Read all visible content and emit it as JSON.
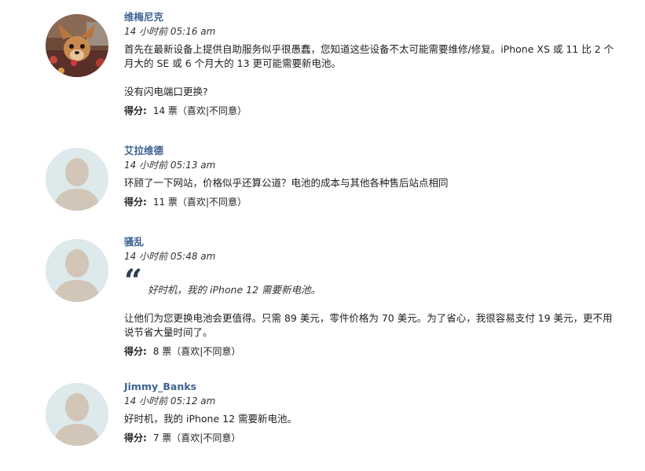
{
  "comments": [
    {
      "author": "维梅尼克",
      "time": "14 小时前 05:16 am",
      "paragraphs": [
        "首先在最新设备上提供自助服务似乎很愚蠢，您知道这些设备不太可能需要维修/修复。iPhone XS 或 11 比 2 个月大的 SE 或 6 个月大的 13 更可能需要新电池。",
        "没有闪电端口更换?"
      ],
      "score_label": "得分:",
      "votes": "14 票",
      "open_paren": "（",
      "like": "喜欢",
      "separator": "|",
      "dislike": "不同意",
      "close_paren": "）"
    },
    {
      "author": "艾拉维德",
      "time": "14 小时前 05:13 am",
      "paragraphs": [
        "环顾了一下网站，价格似乎还算公道？电池的成本与其他各种售后站点相同"
      ],
      "score_label": "得分:",
      "votes": "11 票",
      "open_paren": "（",
      "like": "喜欢",
      "separator": "|",
      "dislike": "不同意",
      "close_paren": "）"
    },
    {
      "author": "骚乱",
      "time": "14 小时前 05:48 am",
      "quote_mark": "“",
      "quote": "好时机，我的 iPhone 12 需要新电池。",
      "paragraphs": [
        "让他们为您更换电池会更值得。只需 89 美元，零件价格为 70 美元。为了省心，我很容易支付 19 美元，更不用说节省大量时间了。"
      ],
      "score_label": "得分:",
      "votes": "8 票",
      "open_paren": "（",
      "like": "喜欢",
      "separator": "|",
      "dislike": "不同意",
      "close_paren": "）"
    },
    {
      "author": "Jimmy_Banks",
      "time": "14 小时前 05:12 am",
      "paragraphs": [
        "好时机，我的 iPhone 12 需要新电池。"
      ],
      "score_label": "得分:",
      "votes": "7 票",
      "open_paren": "（",
      "like": "喜欢",
      "separator": "|",
      "dislike": "不同意",
      "close_paren": "）"
    }
  ],
  "colors": {
    "author": "#3e6391",
    "avatar_bg": "#dde9ea",
    "avatar_figure": "#d2c6b8",
    "quote_mark": "#2c3e54"
  }
}
